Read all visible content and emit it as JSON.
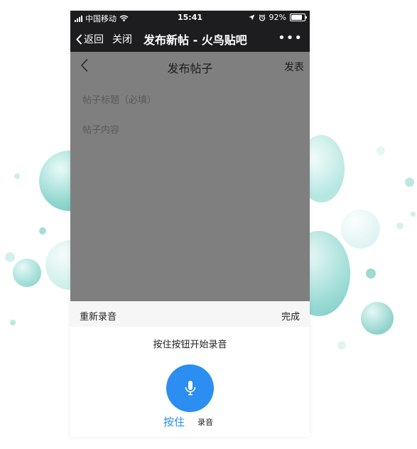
{
  "status_bar": {
    "carrier": "中国移动",
    "time": "15:41",
    "battery": "92%",
    "icons": [
      "signal-icon",
      "wifi-icon",
      "location-icon",
      "alarm-icon",
      "battery-icon"
    ]
  },
  "nav_bar": {
    "back_label": "返回",
    "close_label": "关闭",
    "title": "发布新帖 - 火鸟贴吧",
    "more_label": "•••"
  },
  "page": {
    "title": "发布帖子",
    "publish_label": "发表",
    "title_placeholder": "帖子标题（必填）",
    "content_placeholder": "帖子内容"
  },
  "recorder": {
    "rerecord_label": "重新录音",
    "done_label": "完成",
    "hint": "按住按钮开始录音",
    "mode_hold_label": "按住",
    "mode_record_label": "录音",
    "mic_icon": "microphone-icon"
  },
  "colors": {
    "dark_bar": "#1d1d1f",
    "overlay": "#7f7f7f",
    "accent": "#2b8ef0"
  }
}
